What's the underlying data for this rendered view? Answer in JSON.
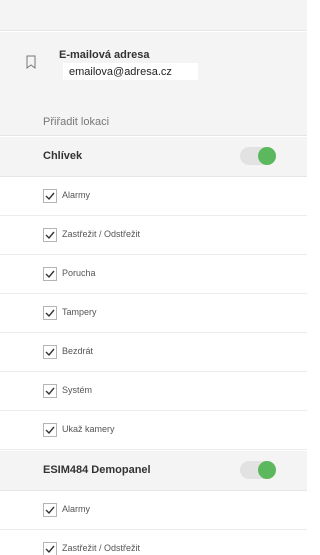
{
  "email": {
    "label": "E-mailová adresa",
    "value": "emailova@adresa.cz"
  },
  "assign": {
    "label": "Přiřadit lokaci"
  },
  "locations": [
    {
      "name": "Chlívek",
      "enabled": true,
      "permissions": [
        {
          "label": "Alarmy",
          "checked": true
        },
        {
          "label": "Zastřežit / Odstřežit",
          "checked": true
        },
        {
          "label": "Porucha",
          "checked": true
        },
        {
          "label": "Tampery",
          "checked": true
        },
        {
          "label": "Bezdrát",
          "checked": true
        },
        {
          "label": "Systém",
          "checked": true
        },
        {
          "label": "Ukaž kamery",
          "checked": true
        }
      ]
    },
    {
      "name": "ESIM484 Demopanel",
      "enabled": true,
      "permissions": [
        {
          "label": "Alarmy",
          "checked": true
        },
        {
          "label": "Zastřežit / Odstřežit",
          "checked": true
        }
      ]
    }
  ],
  "colors": {
    "toggle_on": "#5cb85c",
    "panel_bg": "#f4f4f4"
  },
  "icons": {
    "email": "bookmark-icon",
    "check": "check-icon"
  }
}
